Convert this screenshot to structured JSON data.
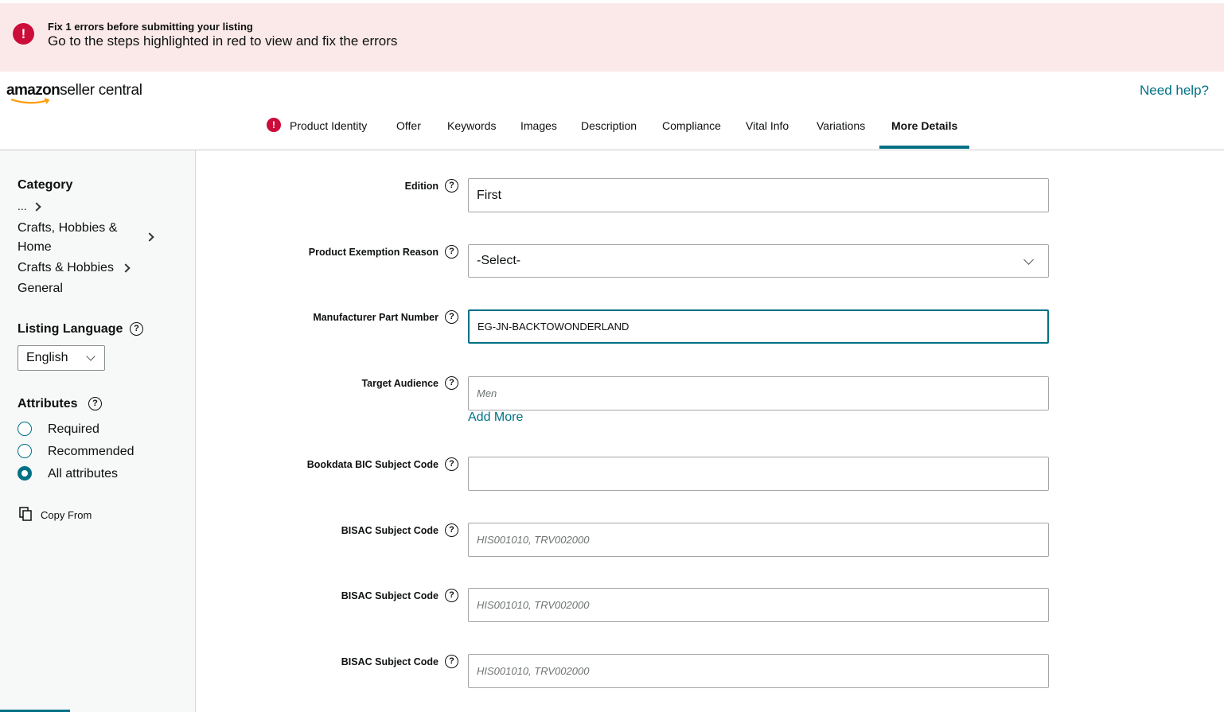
{
  "banner": {
    "icon": "error-icon",
    "title": "Fix 1 errors before submitting your listing",
    "message": "Go to the steps highlighted in red to view and fix the errors",
    "color": "#fbe9e9"
  },
  "header": {
    "logo_brand": "amazon",
    "logo_product": "seller central",
    "help_link": "Need help?"
  },
  "tabs": [
    {
      "label": "Product Identity",
      "error": true
    },
    {
      "label": "Offer"
    },
    {
      "label": "Keywords"
    },
    {
      "label": "Images"
    },
    {
      "label": "Description"
    },
    {
      "label": "Compliance"
    },
    {
      "label": "Vital Info"
    },
    {
      "label": "Variations"
    },
    {
      "label": "More Details",
      "active": true
    }
  ],
  "sidebar": {
    "category_heading": "Category",
    "breadcrumb": [
      "...",
      "Crafts, Hobbies &",
      "Home",
      "Crafts & Hobbies",
      "General"
    ],
    "language_heading": "Listing Language",
    "language_value": "English",
    "attributes_heading": "Attributes",
    "attribute_options": [
      "Required",
      "Recommended",
      "All attributes"
    ],
    "attribute_selected": "All attributes",
    "copy_from": "Copy From"
  },
  "form": {
    "edition": {
      "label": "Edition",
      "value": "First"
    },
    "exemption": {
      "label": "Product Exemption Reason",
      "value": "-Select-"
    },
    "mpn": {
      "label": "Manufacturer Part Number",
      "value": "EG-JN-BACKTOWONDERLAND"
    },
    "audience": {
      "label": "Target Audience",
      "placeholder": "Men",
      "add_more": "Add More"
    },
    "bic": {
      "label": "Bookdata BIC Subject Code",
      "value": ""
    },
    "bisac1": {
      "label": "BISAC Subject Code",
      "placeholder": "HIS001010, TRV002000"
    },
    "bisac2": {
      "label": "BISAC Subject Code",
      "placeholder": "HIS001010, TRV002000"
    },
    "bisac3": {
      "label": "BISAC Subject Code",
      "placeholder": "HIS001010, TRV002000"
    }
  },
  "colors": {
    "accent": "#007185",
    "error": "#cc0c39"
  }
}
